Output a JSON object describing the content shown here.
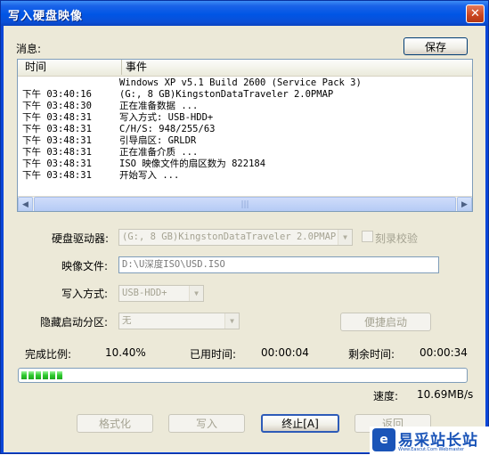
{
  "window": {
    "title": "写入硬盘映像",
    "close_glyph": "✕"
  },
  "log": {
    "label": "消息:",
    "save_button": "保存",
    "columns": {
      "time": "时间",
      "event": "事件"
    },
    "rows": [
      {
        "time": "",
        "event": "Windows XP v5.1 Build 2600 (Service Pack 3)"
      },
      {
        "time": "下午 03:40:16",
        "event": "(G:, 8 GB)KingstonDataTraveler 2.0PMAP"
      },
      {
        "time": "下午 03:48:30",
        "event": "正在准备数据 ..."
      },
      {
        "time": "下午 03:48:31",
        "event": "写入方式: USB-HDD+"
      },
      {
        "time": "下午 03:48:31",
        "event": "C/H/S: 948/255/63"
      },
      {
        "time": "下午 03:48:31",
        "event": "引导扇区: GRLDR"
      },
      {
        "time": "下午 03:48:31",
        "event": "正在准备介质 ..."
      },
      {
        "time": "下午 03:48:31",
        "event": "ISO 映像文件的扇区数为 822184"
      },
      {
        "time": "下午 03:48:31",
        "event": "开始写入 ..."
      }
    ],
    "scroll_grip": "|||"
  },
  "form": {
    "drive_label": "硬盘驱动器:",
    "drive_value": "(G:, 8 GB)KingstonDataTraveler 2.0PMAP",
    "verify_label": "刻录校验",
    "image_label": "映像文件:",
    "image_value": "D:\\U深度ISO\\USD.ISO",
    "write_mode_label": "写入方式:",
    "write_mode_value": "USB-HDD+",
    "hidden_part_label": "隐藏启动分区:",
    "hidden_part_value": "无",
    "quick_boot_button": "便捷启动"
  },
  "progress": {
    "complete_label": "完成比例:",
    "complete_value": "10.40%",
    "complete_fraction": 0.104,
    "elapsed_label": "已用时间:",
    "elapsed_value": "00:00:04",
    "remaining_label": "剩余时间:",
    "remaining_value": "00:00:34",
    "speed_label": "速度:",
    "speed_value": "10.69MB/s"
  },
  "buttons": {
    "format": "格式化",
    "write": "写入",
    "abort": "终止[A]",
    "back": "返回"
  },
  "watermark": {
    "logo": "e",
    "text": "易采站长站",
    "sub": "Www.Eascut.Com Webmaster"
  },
  "colors": {
    "accent": "#0a46d8",
    "progress": "#2ec92e",
    "dialog_bg": "#ece9d8"
  }
}
